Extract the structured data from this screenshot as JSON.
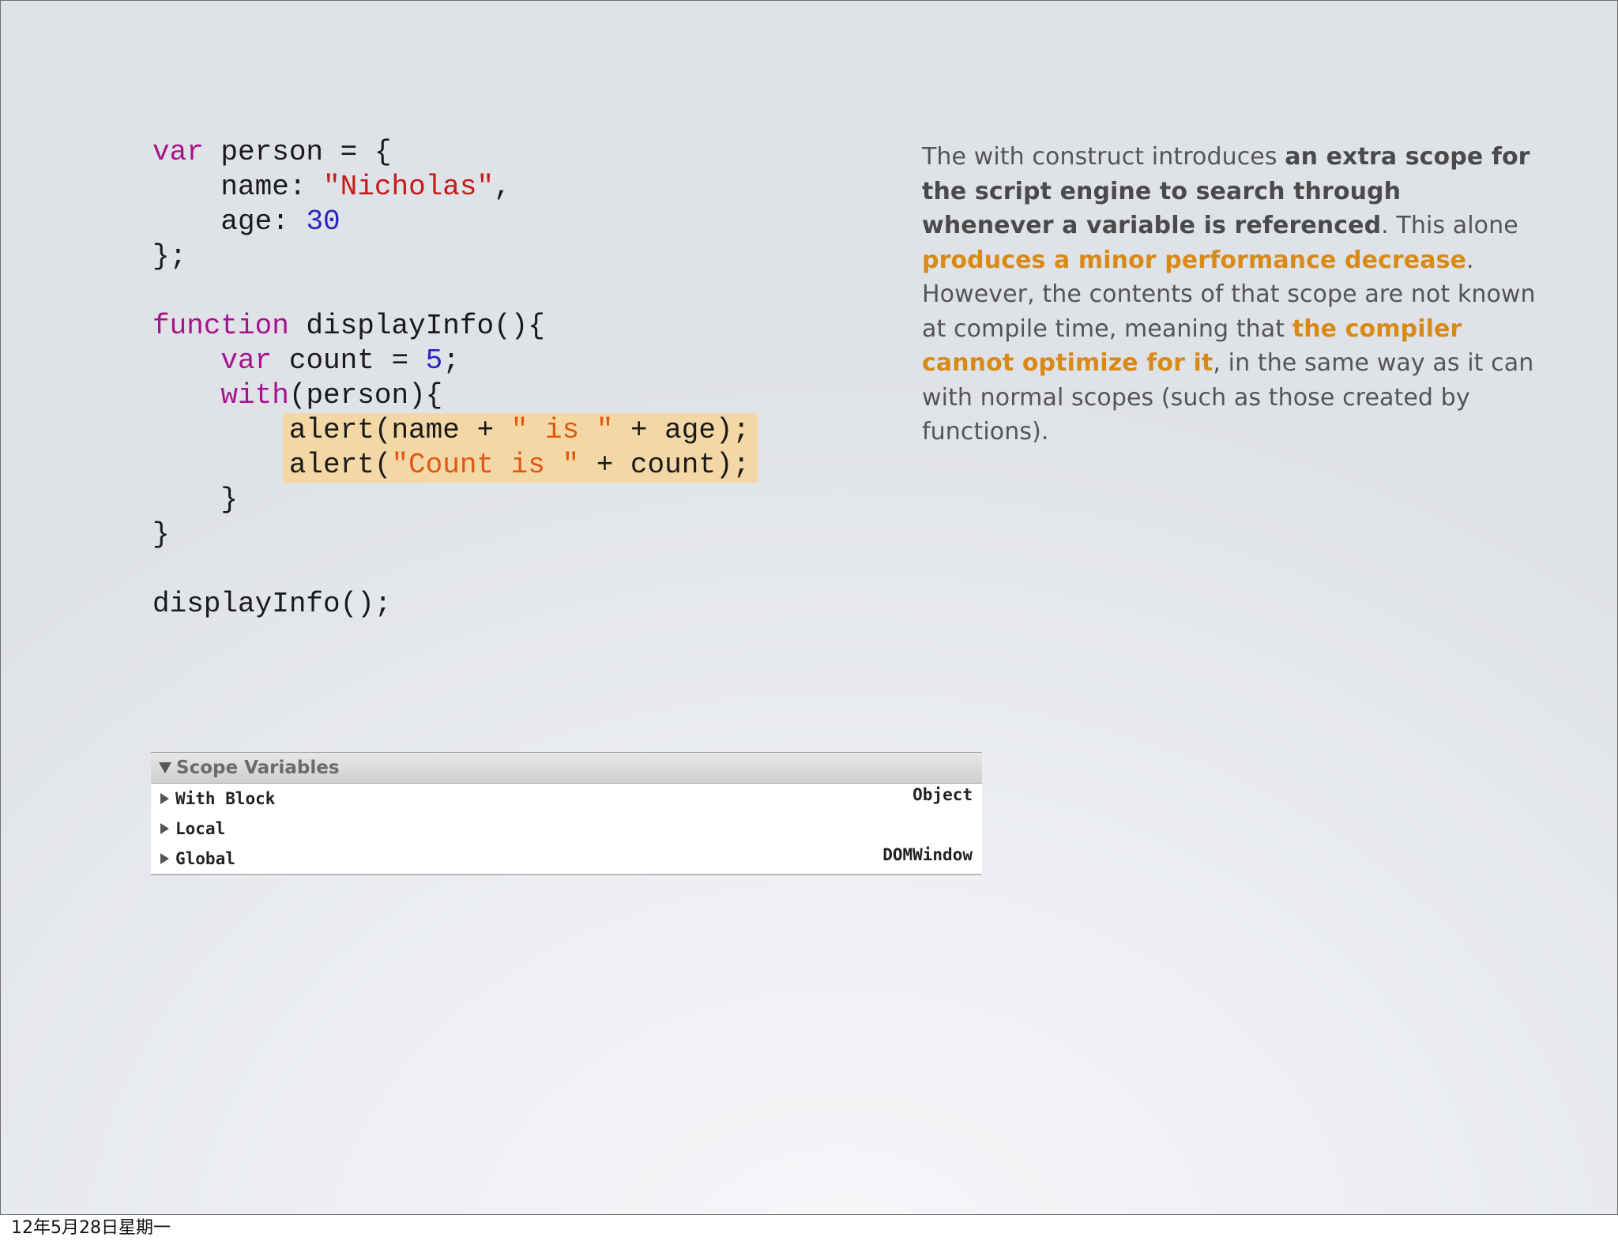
{
  "code_lines": [
    [
      {
        "t": "var",
        "c": "kw"
      },
      {
        "t": " person = {"
      }
    ],
    [
      {
        "t": "    name: "
      },
      {
        "t": "\"Nicholas\"",
        "c": "str"
      },
      {
        "t": ","
      }
    ],
    [
      {
        "t": "    age: "
      },
      {
        "t": "30",
        "c": "num"
      }
    ],
    [
      {
        "t": "};"
      }
    ],
    [
      {
        "t": ""
      }
    ],
    [
      {
        "t": "function",
        "c": "kw"
      },
      {
        "t": " displayInfo(){"
      }
    ],
    [
      {
        "t": "    "
      },
      {
        "t": "var",
        "c": "kw"
      },
      {
        "t": " count = "
      },
      {
        "t": "5",
        "c": "num"
      },
      {
        "t": ";"
      }
    ],
    [
      {
        "t": "    "
      },
      {
        "t": "with",
        "c": "kw"
      },
      {
        "t": "(person){"
      }
    ],
    [
      {
        "t": "        "
      },
      {
        "hl": [
          {
            "t": "alert(name + "
          },
          {
            "t": "\" is \"",
            "c": "hl"
          },
          {
            "t": " + age);"
          }
        ]
      }
    ],
    [
      {
        "t": "        "
      },
      {
        "hl": [
          {
            "t": "alert("
          },
          {
            "t": "\"Count is \"",
            "c": "hl"
          },
          {
            "t": " + count);"
          }
        ]
      }
    ],
    [
      {
        "t": "    }"
      }
    ],
    [
      {
        "t": "}"
      }
    ],
    [
      {
        "t": ""
      }
    ],
    [
      {
        "t": "displayInfo();"
      }
    ]
  ],
  "prose_segments": [
    {
      "t": "The with construct introduces "
    },
    {
      "t": "an extra scope for the script engine to search through whenever a variable is referenced",
      "s": "strong"
    },
    {
      "t": ". This alone "
    },
    {
      "t": "produces a minor performance decrease",
      "s": "accent"
    },
    {
      "t": ". However, the contents of that scope are not known at compile time, meaning that "
    },
    {
      "t": "the compiler cannot optimize for it",
      "s": "accent"
    },
    {
      "t": ", in the same way as it can with normal scopes (such as those created by functions)."
    }
  ],
  "scope_panel": {
    "title": "Scope Variables",
    "rows": [
      {
        "label": "With Block",
        "value": "Object"
      },
      {
        "label": "Local",
        "value": ""
      },
      {
        "label": "Global",
        "value": "DOMWindow"
      }
    ]
  },
  "footer_date": "12年5月28日星期一"
}
